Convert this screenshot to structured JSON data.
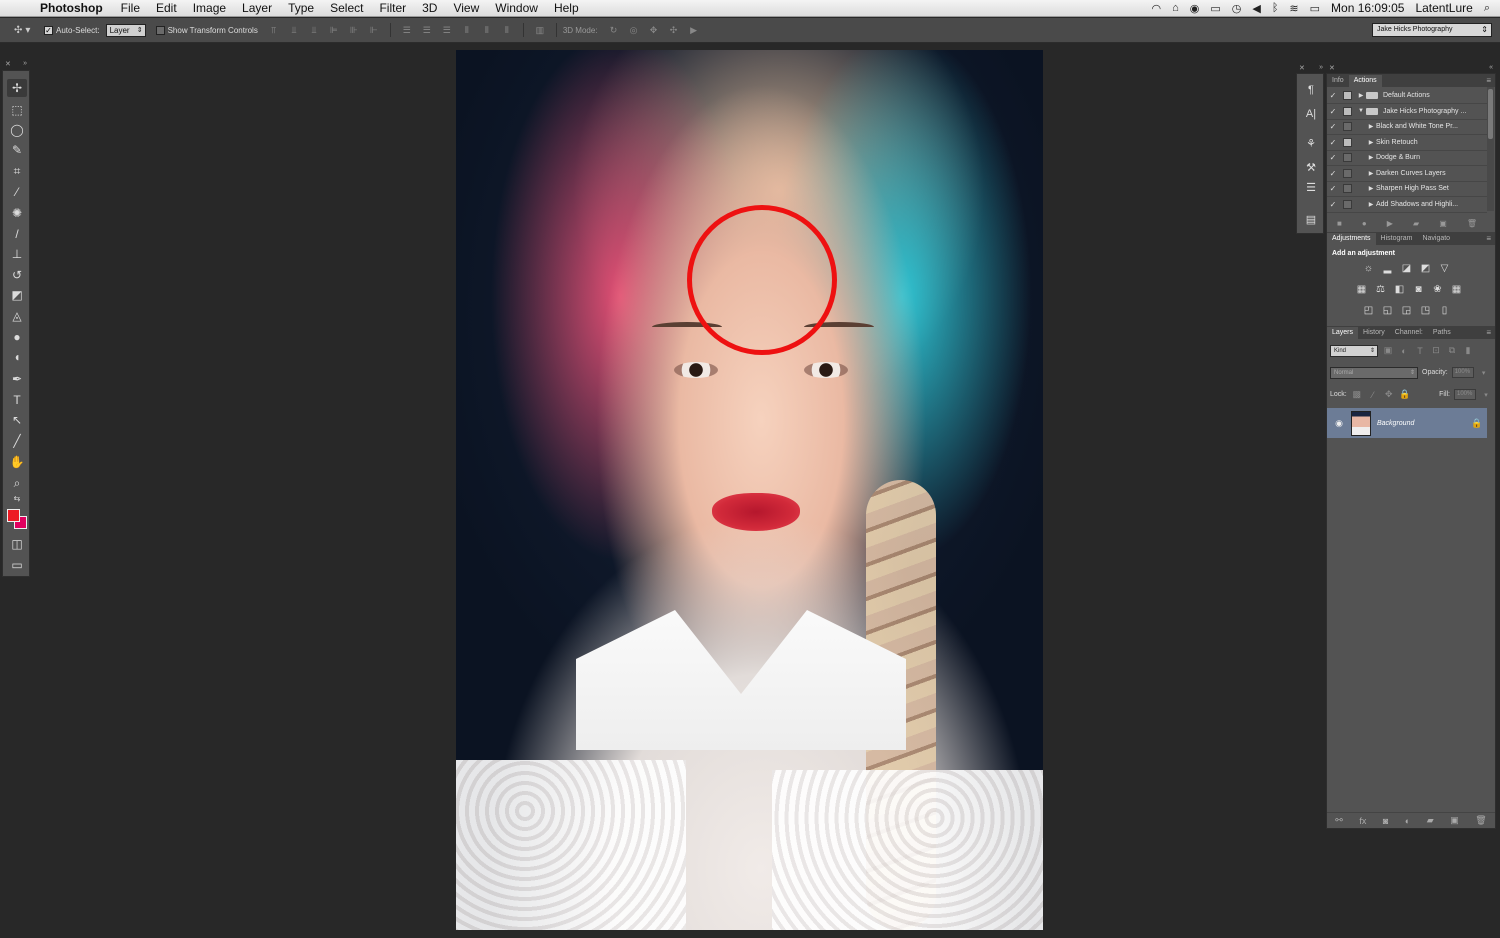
{
  "menubar": {
    "app_name": "Photoshop",
    "menus": [
      "File",
      "Edit",
      "Image",
      "Layer",
      "Type",
      "Select",
      "Filter",
      "3D",
      "View",
      "Window",
      "Help"
    ],
    "clock": "Mon 16:09:05",
    "user": "LatentLure",
    "status_icons": [
      "wifi-icon",
      "drive-icon",
      "accessibility-icon",
      "display-icon",
      "time-machine-icon",
      "volume-icon",
      "bluetooth-icon",
      "wifi-signal-icon",
      "battery-icon",
      "spotlight-icon"
    ]
  },
  "options_bar": {
    "auto_select_label": "Auto-Select:",
    "auto_select_checked": true,
    "auto_select_value": "Layer",
    "transform_label": "Show Transform Controls",
    "transform_checked": false,
    "mode_3d_label": "3D Mode:",
    "workspace": "Jake Hicks Photography"
  },
  "tools": {
    "foreground_color": "#ed1b24",
    "background_color": "#e1005f",
    "items": [
      "move-tool",
      "marquee-tool",
      "lasso-tool",
      "quick-select-tool",
      "crop-tool",
      "eyedropper-tool",
      "spot-healing-tool",
      "brush-tool",
      "clone-stamp-tool",
      "history-brush-tool",
      "eraser-tool",
      "paint-bucket-tool",
      "blur-tool",
      "dodge-tool",
      "pen-tool",
      "type-tool",
      "path-select-tool",
      "line-tool",
      "hand-tool",
      "zoom-tool"
    ]
  },
  "canvas": {
    "highlight_color": "#ee1111"
  },
  "actions_panel": {
    "tabs": [
      "Info",
      "Actions"
    ],
    "active_tab": "Actions",
    "rows": [
      {
        "label": "Default Actions",
        "folder": true,
        "expanded": false,
        "dialog": true
      },
      {
        "label": "Jake Hicks Photography ...",
        "folder": true,
        "expanded": true,
        "dialog": true
      },
      {
        "label": "Black and White Tone Pr...",
        "folder": false,
        "expanded": false,
        "dialog": false
      },
      {
        "label": "Skin Retouch",
        "folder": false,
        "expanded": false,
        "dialog": true
      },
      {
        "label": "Dodge & Burn",
        "folder": false,
        "expanded": false,
        "dialog": false
      },
      {
        "label": "Darken Curves Layers",
        "folder": false,
        "expanded": false,
        "dialog": false
      },
      {
        "label": "Sharpen High Pass Set",
        "folder": false,
        "expanded": false,
        "dialog": false
      },
      {
        "label": "Add Shadows and Highli...",
        "folder": false,
        "expanded": false,
        "dialog": false
      }
    ]
  },
  "adjustments_panel": {
    "tabs": [
      "Adjustments",
      "Histogram",
      "Navigato"
    ],
    "active_tab": "Adjustments",
    "title": "Add an adjustment"
  },
  "layers_panel": {
    "tabs": [
      "Layers",
      "History",
      "Channel:",
      "Paths"
    ],
    "active_tab": "Layers",
    "kind_label": "Kind",
    "blend_mode": "Normal",
    "opacity_label": "Opacity:",
    "opacity_value": "100%",
    "lock_label": "Lock:",
    "fill_label": "Fill:",
    "fill_value": "100%",
    "layers": [
      {
        "name": "Background",
        "visible": true,
        "locked": true
      }
    ]
  }
}
